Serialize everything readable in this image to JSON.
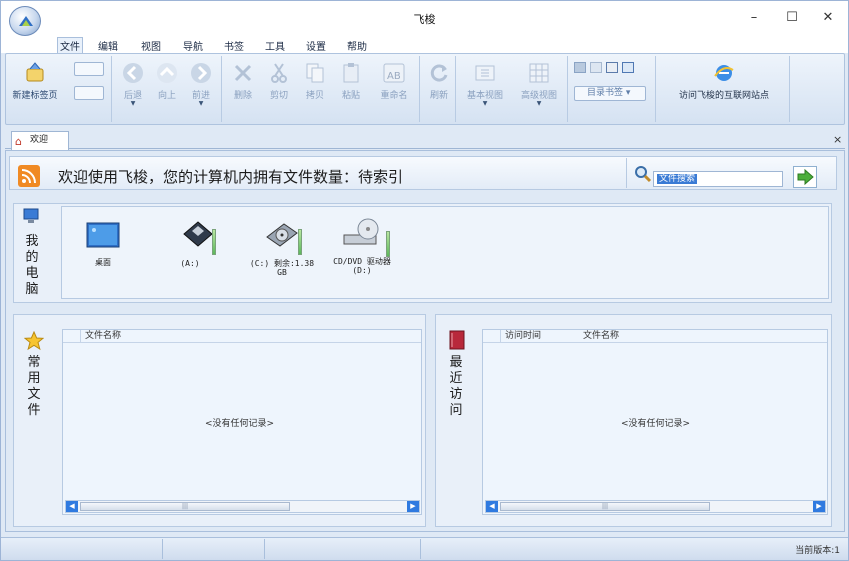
{
  "window": {
    "title": "飞梭",
    "minimize": "–",
    "maximize": "☐",
    "close": "✕"
  },
  "menu": {
    "items": [
      "文件",
      "编辑",
      "视图",
      "导航",
      "书签",
      "工具",
      "设置",
      "帮助"
    ],
    "active": "文件"
  },
  "ribbon": {
    "new_tab": "新建标签页",
    "back": "后退",
    "up": "向上",
    "forward": "前进",
    "delete": "删除",
    "cut": "剪切",
    "copy": "拷贝",
    "paste": "粘贴",
    "rename": "重命名",
    "refresh": "刷新",
    "basic_view": "基本视图",
    "advanced_view": "高级视图",
    "dir_bookmark": "目录书签",
    "visit_site": "访问飞梭的互联网站点"
  },
  "tab": {
    "label": "欢迎",
    "close": "×"
  },
  "welcome": {
    "text": "欢迎使用飞梭，您的计算机内拥有文件数量：待索引",
    "search_placeholder": "文件搜索"
  },
  "my_computer": {
    "label": [
      "我",
      "的",
      "电",
      "脑"
    ],
    "drives": [
      {
        "name": "桌面",
        "icon": "desktop-icon"
      },
      {
        "name": "(A:)",
        "icon": "floppy-icon"
      },
      {
        "name": "(C:) 剩余:1.38 GB",
        "name_line1": "(C:) 剩余:1.38",
        "name_line2": "GB",
        "icon": "hard-disk-icon"
      },
      {
        "name": "CD/DVD 驱动器 (D:)",
        "name_line1": "CD/DVD 驱动器",
        "name_line2": "(D:)",
        "icon": "cd-drive-icon"
      }
    ]
  },
  "favorites": {
    "label": [
      "常",
      "用",
      "文",
      "件"
    ],
    "columns": [
      "文件名称"
    ],
    "empty": "<没有任何记录>",
    "scroll_grip": "|||"
  },
  "recent": {
    "label": [
      "最",
      "近",
      "访",
      "问"
    ],
    "columns": [
      "访问时间",
      "文件名称"
    ],
    "empty": "<没有任何记录>",
    "scroll_grip": "|||"
  },
  "status": {
    "version": "当前版本:1"
  },
  "colors": {
    "accent": "#2f7ae0",
    "rss": "#f08a24",
    "frame": "#dfe9f5"
  }
}
